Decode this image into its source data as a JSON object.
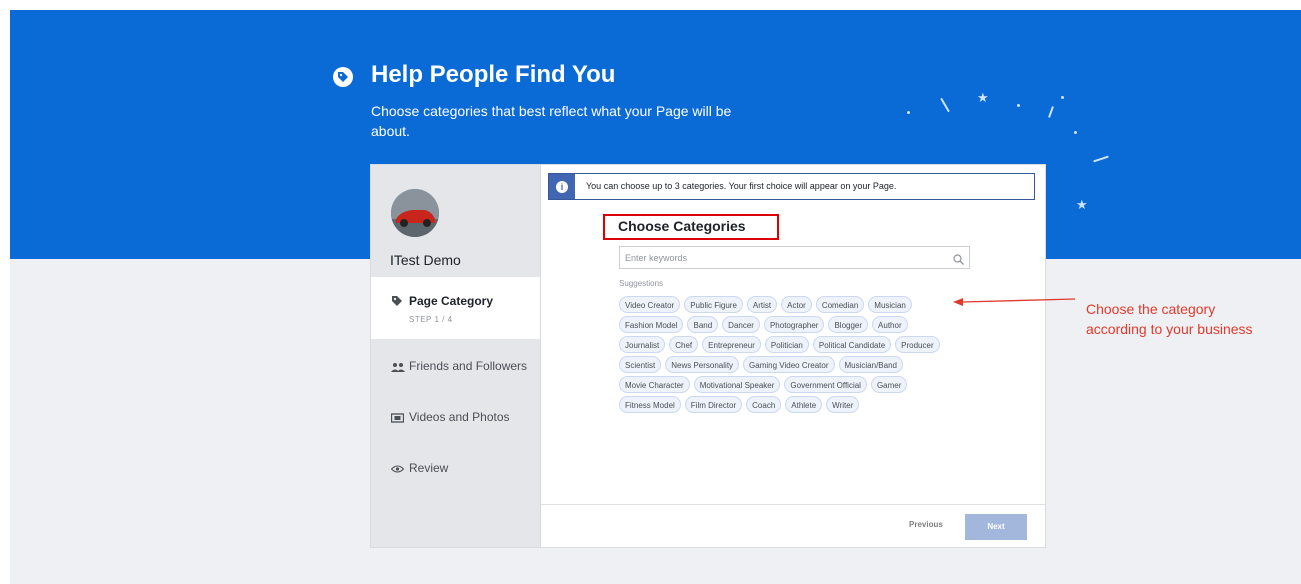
{
  "hero": {
    "title": "Help People Find You",
    "subtitle": "Choose categories that best reflect what your Page will be about."
  },
  "sidebar": {
    "page_name": "ITest Demo",
    "steps": [
      {
        "label": "Page Category",
        "sublabel": "STEP 1 / 4",
        "icon": "tag-icon"
      },
      {
        "label": "Friends and Followers",
        "icon": "people-icon"
      },
      {
        "label": "Videos and Photos",
        "icon": "video-icon"
      },
      {
        "label": "Review",
        "icon": "eye-icon"
      }
    ]
  },
  "main": {
    "info_text": "You can choose up to 3 categories. Your first choice will appear on your Page.",
    "title": "Choose Categories",
    "search_placeholder": "Enter keywords",
    "suggestions_label": "Suggestions",
    "categories": [
      "Video Creator",
      "Public Figure",
      "Artist",
      "Actor",
      "Comedian",
      "Musician",
      "Fashion Model",
      "Band",
      "Dancer",
      "Photographer",
      "Blogger",
      "Author",
      "Journalist",
      "Chef",
      "Entrepreneur",
      "Politician",
      "Political Candidate",
      "Producer",
      "Scientist",
      "News Personality",
      "Gaming Video Creator",
      "Musician/Band",
      "Movie Character",
      "Motivational Speaker",
      "Government Official",
      "Gamer",
      "Fitness Model",
      "Film Director",
      "Coach",
      "Athlete",
      "Writer"
    ]
  },
  "footer": {
    "previous_label": "Previous",
    "next_label": "Next"
  },
  "annotation": {
    "line1": "Choose the category",
    "line2": "according to your business"
  },
  "colors": {
    "hero_blue": "#0b6bd6",
    "accent": "#4267b2",
    "annotation_red": "#e03a2c"
  }
}
